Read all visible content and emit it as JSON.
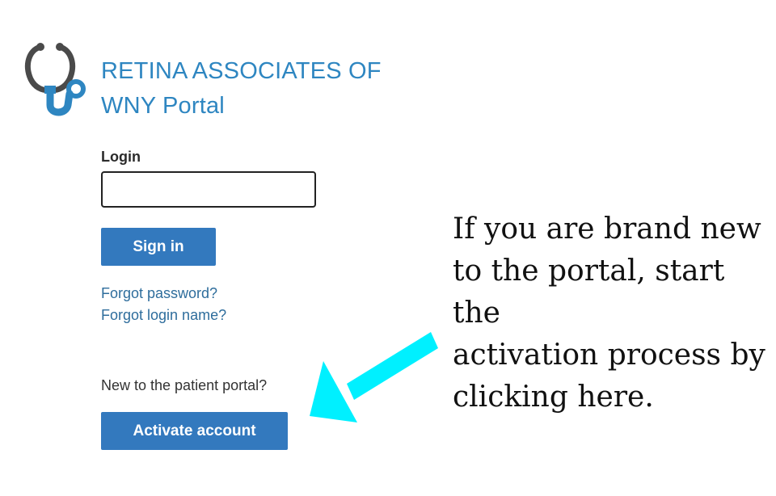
{
  "header": {
    "title_line1": "RETINA ASSOCIATES OF",
    "title_line2": "WNY Portal",
    "logo_icon": "stethoscope-icon",
    "brand_color": "#2e86c1"
  },
  "login_form": {
    "label": "Login",
    "input_value": "",
    "sign_in_label": "Sign in",
    "forgot_password_label": "Forgot password?",
    "forgot_login_label": "Forgot login name?"
  },
  "activation": {
    "prompt": "New to the patient portal?",
    "button_label": "Activate account"
  },
  "annotation": {
    "lines": [
      "If you are brand new",
      "to the portal, start the",
      "activation process by",
      "clicking here."
    ],
    "arrow_icon": "arrow-pointer-icon",
    "arrow_color": "#00f0ff"
  },
  "colors": {
    "button_bg": "#3379be",
    "link": "#2e6d9c"
  }
}
